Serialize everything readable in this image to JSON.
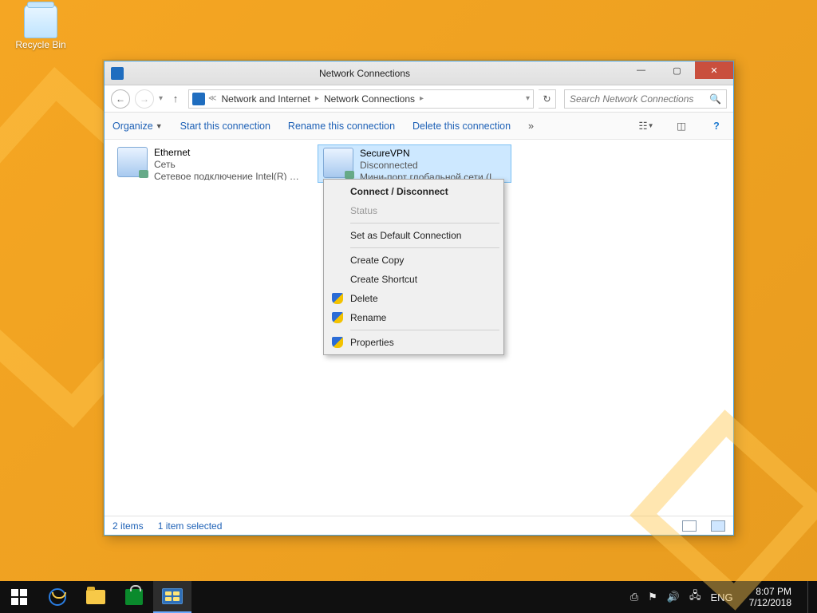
{
  "desktop": {
    "recycle_bin": "Recycle Bin"
  },
  "window": {
    "title": "Network Connections",
    "breadcrumb": {
      "a": "Network and Internet",
      "b": "Network Connections"
    },
    "search_placeholder": "Search Network Connections",
    "commands": {
      "organize": "Organize",
      "start": "Start this connection",
      "rename": "Rename this connection",
      "delete": "Delete this connection"
    },
    "connections": [
      {
        "name": "Ethernet",
        "status": "Сеть",
        "device": "Сетевое подключение Intel(R) P..."
      },
      {
        "name": "SecureVPN",
        "status": "Disconnected",
        "device": "Мини-порт глобальной сети (IK..."
      }
    ],
    "context_menu": {
      "connect": "Connect / Disconnect",
      "status": "Status",
      "default": "Set as Default Connection",
      "copy": "Create Copy",
      "shortcut": "Create Shortcut",
      "delete": "Delete",
      "rename": "Rename",
      "properties": "Properties"
    },
    "statusbar": {
      "items": "2 items",
      "selected": "1 item selected"
    }
  },
  "taskbar": {
    "lang": "ENG",
    "time": "8:07 PM",
    "date": "7/12/2018"
  }
}
